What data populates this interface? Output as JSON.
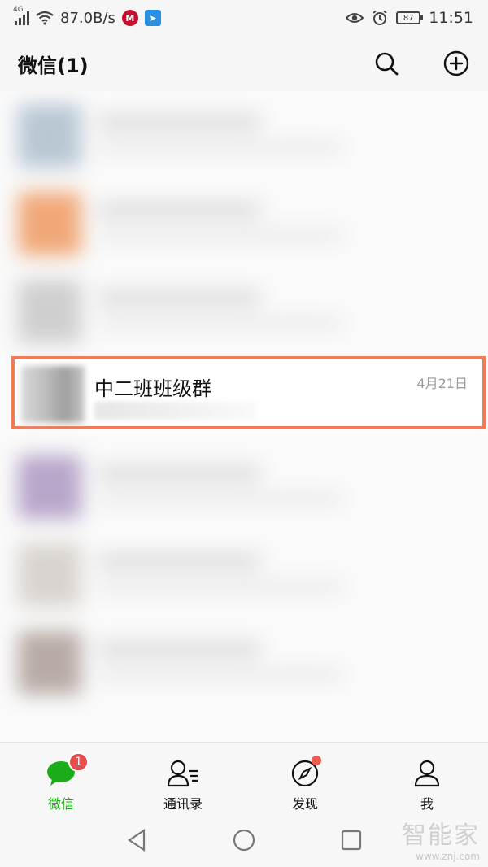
{
  "status_bar": {
    "network_label": "4G",
    "net_speed": "87.0B/s",
    "app_badge_1": "M",
    "app_badge_2": "➤",
    "battery_level": "87",
    "time": "11:51"
  },
  "header": {
    "title": "微信(1)",
    "search_icon": "search-icon",
    "add_icon": "plus-circle-icon"
  },
  "highlighted_chat": {
    "name": "中二班班级群",
    "date": "4月21日",
    "highlight_color": "#ee7d55"
  },
  "tabs": [
    {
      "label": "微信",
      "icon": "chat-bubble-icon",
      "badge": "1",
      "active": true
    },
    {
      "label": "通讯录",
      "icon": "contacts-icon"
    },
    {
      "label": "发现",
      "icon": "compass-icon",
      "dot": true
    },
    {
      "label": "我",
      "icon": "person-icon"
    }
  ],
  "colors": {
    "accent": "#1aad19",
    "badge": "#e84c4c"
  },
  "watermark": {
    "main": "智能家",
    "sub": "www.znj.com"
  }
}
